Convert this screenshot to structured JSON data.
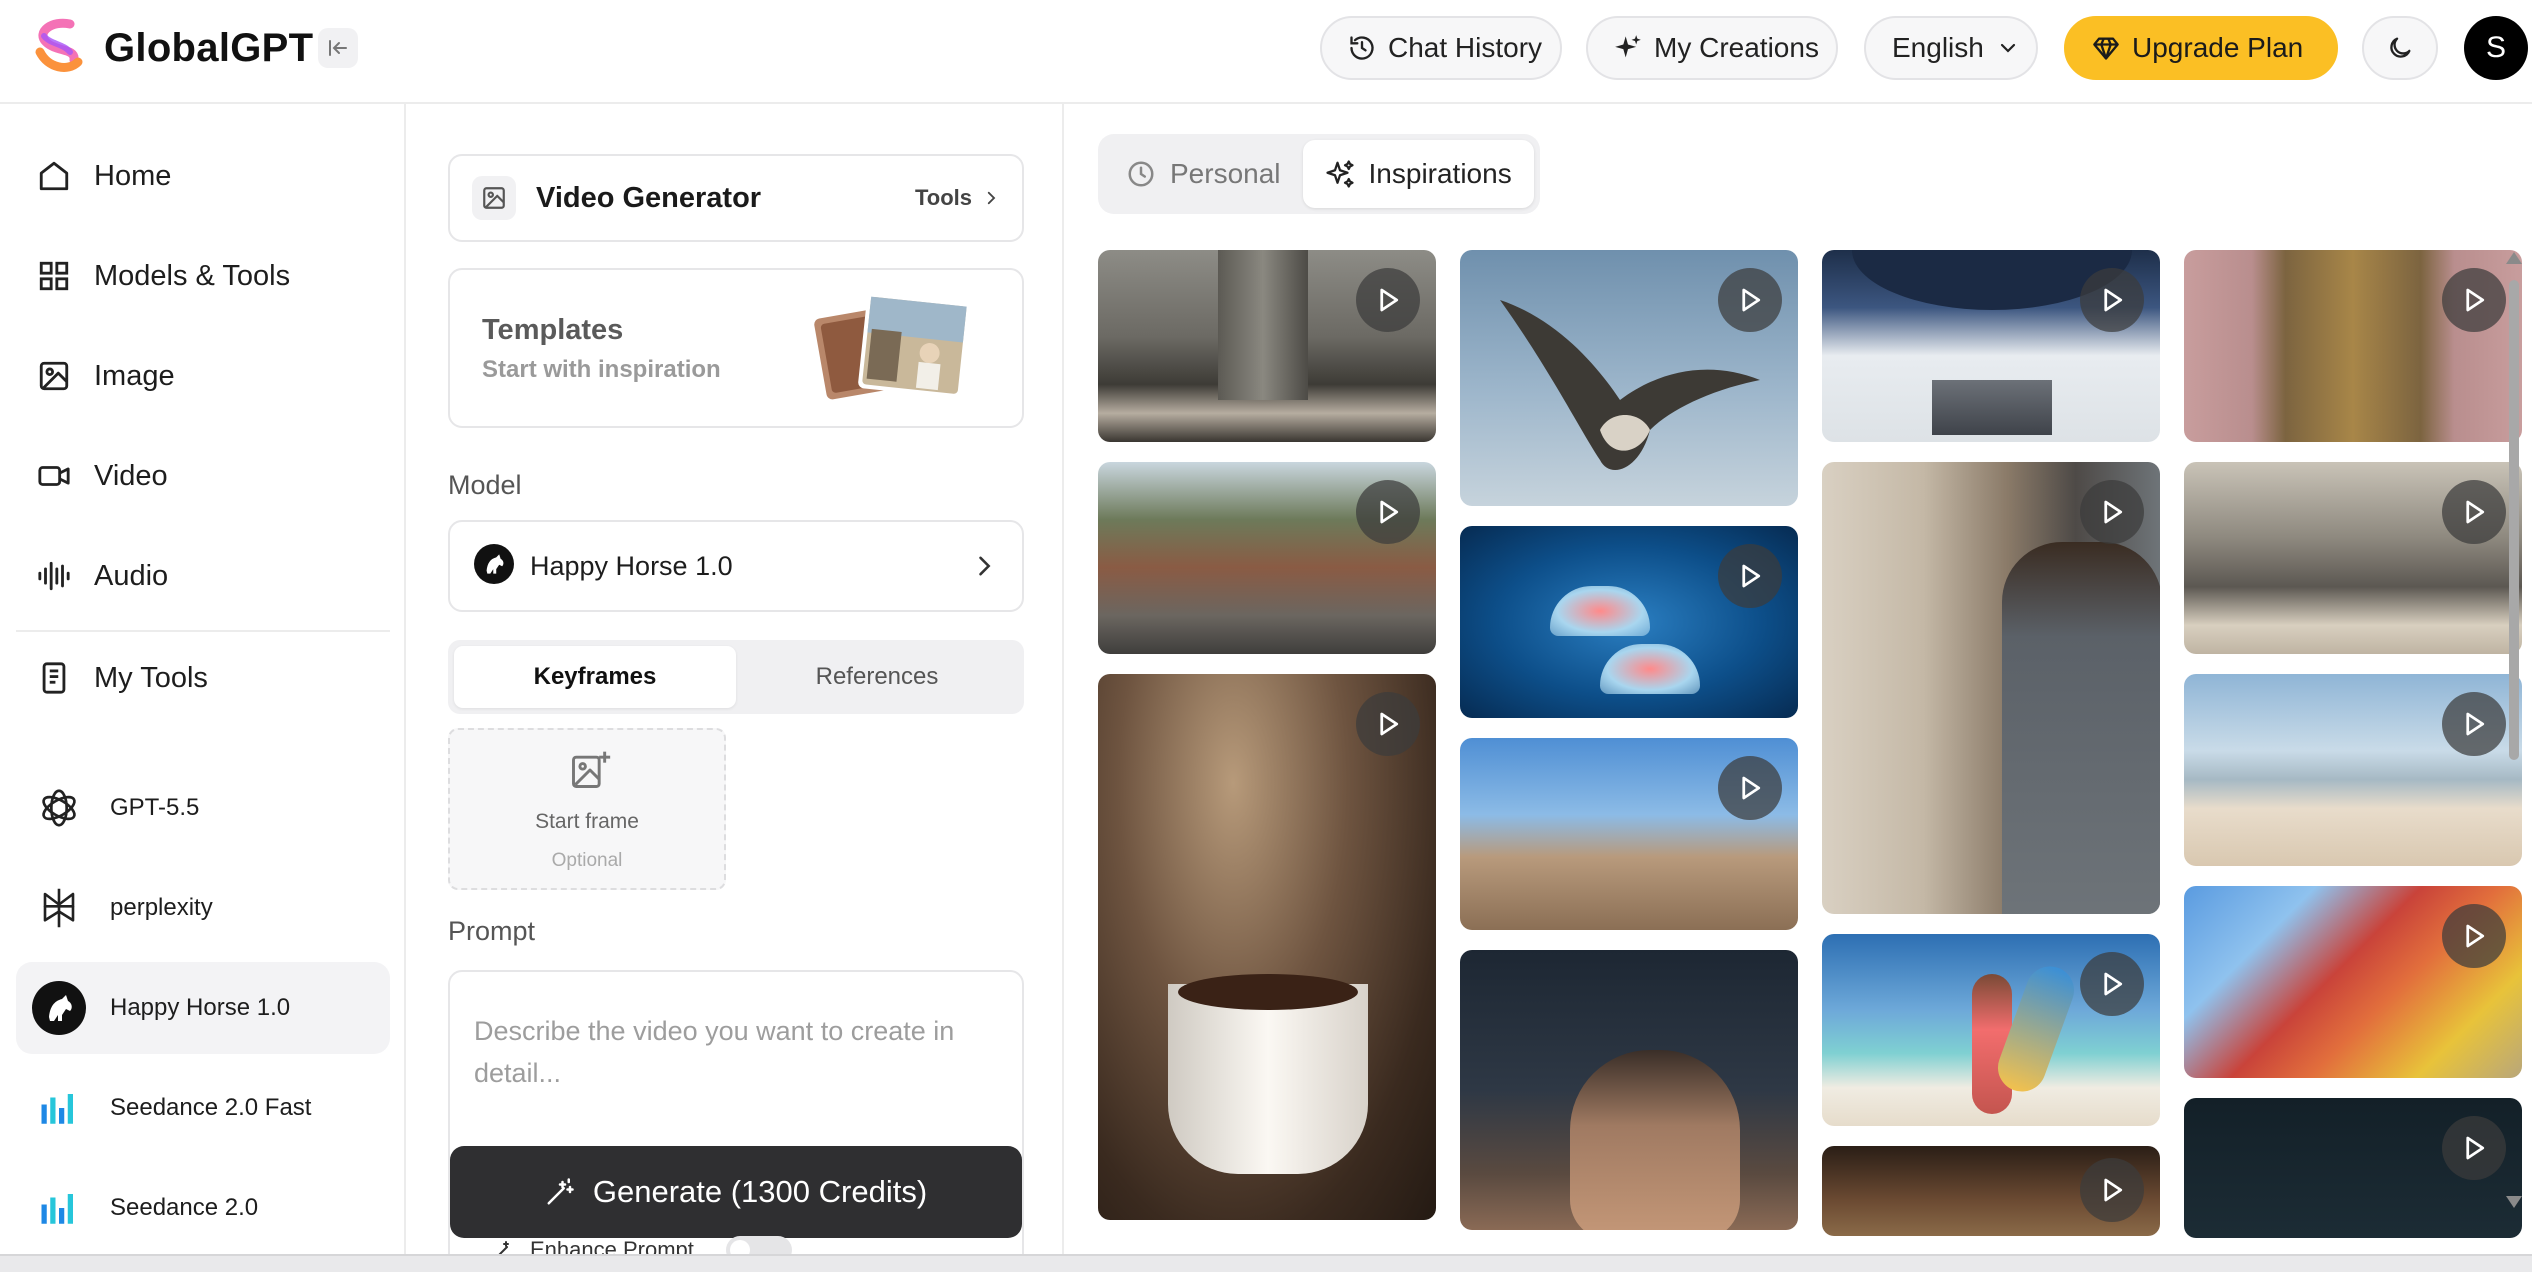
{
  "header": {
    "brand": "GlobalGPT",
    "chat_history": "Chat History",
    "my_creations": "My Creations",
    "language": "English",
    "upgrade": "Upgrade Plan",
    "avatar_initial": "S",
    "accent_color": "#fbbf24"
  },
  "sidebar": {
    "nav": [
      {
        "label": "Home",
        "icon": "home-icon"
      },
      {
        "label": "Models & Tools",
        "icon": "grid-icon"
      },
      {
        "label": "Image",
        "icon": "image-icon"
      },
      {
        "label": "Video",
        "icon": "video-icon"
      },
      {
        "label": "Audio",
        "icon": "audio-wave-icon"
      },
      {
        "label": "My Tools",
        "icon": "document-icon"
      }
    ],
    "models": [
      {
        "label": "GPT-5.5",
        "icon": "openai-icon"
      },
      {
        "label": "perplexity",
        "icon": "perplexity-icon"
      },
      {
        "label": "Happy Horse 1.0",
        "icon": "horse-icon",
        "active": true
      },
      {
        "label": "Seedance 2.0 Fast",
        "icon": "seedance-icon"
      },
      {
        "label": "Seedance 2.0",
        "icon": "seedance-icon"
      }
    ]
  },
  "generator": {
    "title": "Video Generator",
    "tools_label": "Tools",
    "templates_title": "Templates",
    "templates_sub": "Start with inspiration",
    "model_label": "Model",
    "model_value": "Happy Horse 1.0",
    "tabs": [
      "Keyframes",
      "References"
    ],
    "active_tab": "Keyframes",
    "start_frame": "Start frame",
    "optional": "Optional",
    "prompt_label": "Prompt",
    "prompt_placeholder": "Describe the video you want to create in detail...",
    "generate": "Generate (1300 Credits)",
    "enhance": "Enhance Prompt"
  },
  "gallery": {
    "tabs": [
      "Personal",
      "Inspirations"
    ],
    "active_tab": "Inspirations",
    "thumbnails": [
      {
        "name": "brutalist-tower"
      },
      {
        "name": "city-street"
      },
      {
        "name": "coffee-cup"
      },
      {
        "name": "flying-bird"
      },
      {
        "name": "jellyfish"
      },
      {
        "name": "boardwalk-crowd"
      },
      {
        "name": "woman-with-phone"
      },
      {
        "name": "space-station-crowd"
      },
      {
        "name": "man-at-door"
      },
      {
        "name": "surfer-on-beach"
      },
      {
        "name": "dim-room"
      },
      {
        "name": "elevator-doors"
      },
      {
        "name": "concrete-monolith"
      },
      {
        "name": "beach-yoga"
      },
      {
        "name": "colorful-playground"
      },
      {
        "name": "dark-scene"
      }
    ]
  }
}
